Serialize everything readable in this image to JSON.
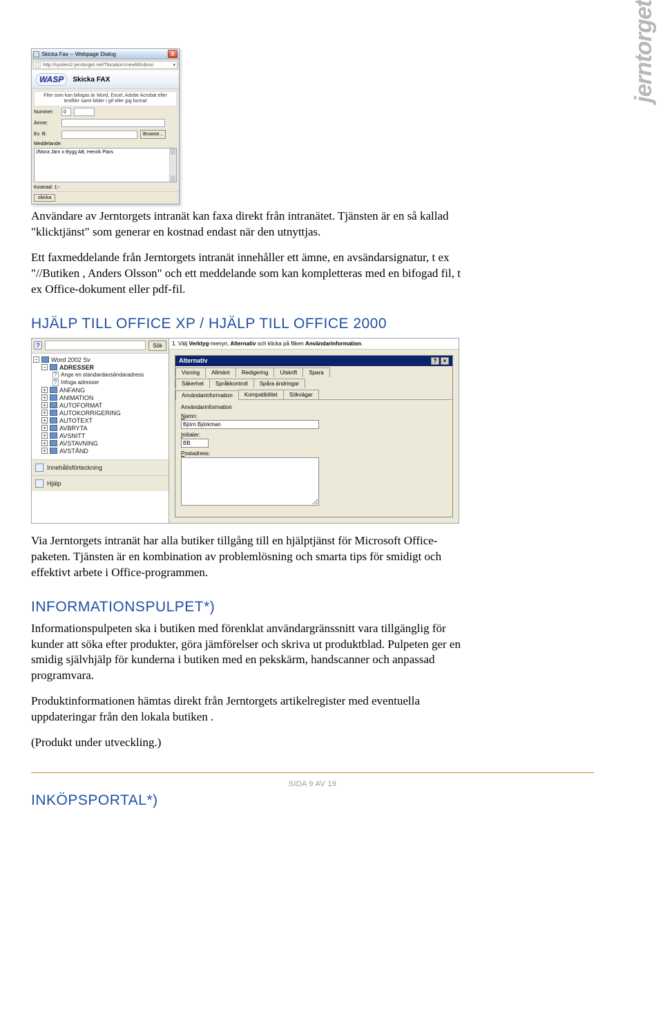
{
  "brand": "jerntorget",
  "fax": {
    "window_title": "Skicka Fax -- Webpage Dialog",
    "url": "http://system2.jerntorget.net/?location=newWin&mo",
    "logo_text": "WASP",
    "banner_title": "Skicka FAX",
    "info_text": "Filer som kan bifogas är Word, Excel, Adobe Acrobat eller textfiler samt bilder i gif eller jpg format",
    "label_nummer": "Nummer:",
    "nummer_prefix": "0",
    "nummer_value": "",
    "label_amne": "Ämne:",
    "amne_value": "",
    "label_fil": "Ev. fil:",
    "fil_value": "",
    "browse_label": "Browse...",
    "label_meddelande": "Meddelande:",
    "meddelande_value": "//Mora Järn o Bygg AB, Henrik Plars",
    "kostnad_label": "Kostnad: 1:-",
    "skicka_label": "skicka",
    "close_label": "X"
  },
  "fax_para1": "Användare av Jerntorgets intranät kan faxa direkt från intranätet. Tjänsten är en så kallad \"klicktjänst\" som generar en kostnad endast när den utnyttjas.",
  "fax_para2": "Ett faxmeddelande från Jerntorgets intranät innehåller ett ämne, en avsändarsignatur, t ex \"//Butiken , Anders Olsson\" och ett meddelande som kan kompletteras med en bifogad fil, t ex Office-dokument eller pdf-fil.",
  "heading_office": "HJÄLP TILL OFFICE XP / HJÄLP TILL OFFICE 2000",
  "office": {
    "search_button": "Sök",
    "tree_root": "Word 2002 Sv",
    "tree_adresser": "ADRESSER",
    "tree_adresser_c1": "Ange en standardavsändaradress",
    "tree_adresser_c2": "Infoga adresser",
    "tree_items": [
      "ANFANG",
      "ANIMATION",
      "AUTOFORMAT",
      "AUTOKORRIGERING",
      "AUTOTEXT",
      "AVBRYTA",
      "AVSNITT",
      "AVSTAVNING",
      "AVSTÅND"
    ],
    "toc_label": "Innehållsförteckning",
    "help_label": "Hjälp",
    "instruction_prefix": "1. Välj",
    "instruction_bold1": "Verktyg",
    "instruction_mid1": "-menyn,",
    "instruction_bold2": "Alternativ",
    "instruction_mid2": "och klicka på fliken",
    "instruction_bold3": "Användarinformation",
    "instruction_end": ".",
    "dialog_title": "Alternativ",
    "tabs_row1": [
      "Visning",
      "Allmänt",
      "Redigering",
      "Utskrift",
      "Spara"
    ],
    "tabs_row2": [
      "Säkerhet",
      "Språkkontroll",
      "Spåra ändringar"
    ],
    "tabs_row3": [
      "Användarinformation",
      "Kompatibilitet",
      "Sökvägar"
    ],
    "section_label": "Användarinformation",
    "label_namn": "Namn:",
    "value_namn": "Björn Björkman",
    "label_initialer": "Initialer:",
    "value_initialer": "BB",
    "label_postadress": "Postadress:"
  },
  "office_para": "Via Jerntorgets intranät har alla butiker tillgång till en hjälptjänst för Microsoft Office-paketen. Tjänsten är en kombination av problemlösning och smarta tips för smidigt och effektivt arbete i Office-programmen.",
  "heading_pulpet": "INFORMATIONSPULPET*)",
  "pulpet_p1": "Informationspulpeten ska i butiken med förenklat användargränssnitt vara tillgänglig för kunder att söka efter produkter, göra jämförelser och skriva ut produktblad. Pulpeten ger en smidig självhjälp för kunderna i butiken med en pekskärm, handscanner och anpassad programvara.",
  "pulpet_p2": "Produktinformationen hämtas direkt från Jerntorgets artikelregister med eventuella uppdateringar från den lokala butiken .",
  "pulpet_p3": "(Produkt under utveckling.)",
  "heading_inkop": "INKÖPSPORTAL*)",
  "footer": "SIDA 9 AV 19"
}
